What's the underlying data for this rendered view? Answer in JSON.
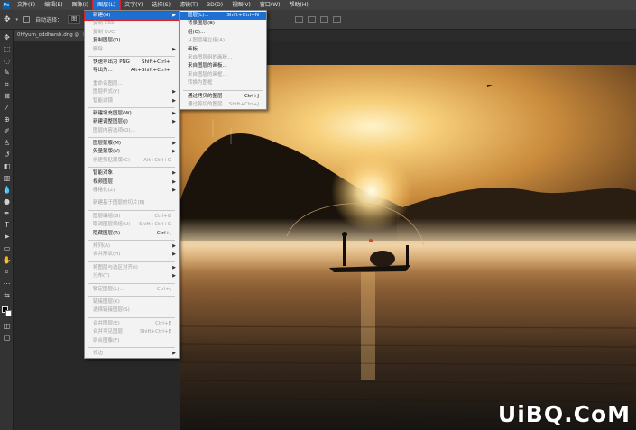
{
  "menubar": {
    "items": [
      {
        "label": "文件(F)"
      },
      {
        "label": "编辑(E)"
      },
      {
        "label": "图像(I)"
      },
      {
        "label": "图层(L)",
        "active": true
      },
      {
        "label": "文字(Y)"
      },
      {
        "label": "选择(S)"
      },
      {
        "label": "滤镜(T)"
      },
      {
        "label": "3D(D)"
      },
      {
        "label": "视图(V)"
      },
      {
        "label": "窗口(W)"
      },
      {
        "label": "帮助(H)"
      }
    ]
  },
  "options_bar": {
    "auto_select_label": "自动选择：",
    "auto_select_value": "图"
  },
  "document_tab": {
    "title": "0hfyum_oddharsh.dng @"
  },
  "layer_menu": {
    "items": [
      {
        "label": "新建(N)",
        "submenu": true,
        "highlighted": true
      },
      {
        "label": "复制 CSS",
        "disabled": true
      },
      {
        "label": "复制 SVG",
        "disabled": true
      },
      {
        "label": "复制图层(D)...",
        "disabled": false
      },
      {
        "label": "删除",
        "submenu": true,
        "disabled": true
      },
      {
        "separator": true
      },
      {
        "label": "快速导出为 PNG",
        "shortcut": "Shift+Ctrl+'"
      },
      {
        "label": "导出为...",
        "shortcut": "Alt+Shift+Ctrl+'"
      },
      {
        "separator": true
      },
      {
        "label": "重命名图层...",
        "disabled": true
      },
      {
        "label": "图层样式(Y)",
        "submenu": true,
        "disabled": true
      },
      {
        "label": "智能滤镜",
        "submenu": true,
        "disabled": true
      },
      {
        "separator": true
      },
      {
        "label": "新建填充图层(W)",
        "submenu": true
      },
      {
        "label": "新建调整图层(J)",
        "submenu": true
      },
      {
        "label": "图层内容选项(O)...",
        "disabled": true
      },
      {
        "separator": true
      },
      {
        "label": "图层蒙版(M)",
        "submenu": true
      },
      {
        "label": "矢量蒙版(V)",
        "submenu": true
      },
      {
        "label": "创建剪贴蒙版(C)",
        "shortcut": "Alt+Ctrl+G",
        "disabled": true
      },
      {
        "separator": true
      },
      {
        "label": "智能对象",
        "submenu": true
      },
      {
        "label": "视频图层",
        "submenu": true
      },
      {
        "label": "栅格化(Z)",
        "submenu": true,
        "disabled": true
      },
      {
        "separator": true
      },
      {
        "label": "新建基于图层的切片(B)",
        "disabled": true
      },
      {
        "separator": true
      },
      {
        "label": "图层编组(G)",
        "shortcut": "Ctrl+G",
        "disabled": true
      },
      {
        "label": "取消图层编组(U)",
        "shortcut": "Shift+Ctrl+G",
        "disabled": true
      },
      {
        "label": "隐藏图层(R)",
        "shortcut": "Ctrl+,"
      },
      {
        "separator": true
      },
      {
        "label": "排列(A)",
        "submenu": true,
        "disabled": true
      },
      {
        "label": "合并形状(H)",
        "submenu": true,
        "disabled": true
      },
      {
        "separator": true
      },
      {
        "label": "将图层与选区对齐(I)",
        "submenu": true,
        "disabled": true
      },
      {
        "label": "分布(T)",
        "submenu": true,
        "disabled": true
      },
      {
        "separator": true
      },
      {
        "label": "锁定图层(L)...",
        "shortcut": "Ctrl+/",
        "disabled": true
      },
      {
        "separator": true
      },
      {
        "label": "链接图层(K)",
        "disabled": true
      },
      {
        "label": "选择链接图层(S)",
        "disabled": true
      },
      {
        "separator": true
      },
      {
        "label": "合并图层(E)",
        "shortcut": "Ctrl+E",
        "disabled": true
      },
      {
        "label": "合并可见图层",
        "shortcut": "Shift+Ctrl+E",
        "disabled": true
      },
      {
        "label": "拼合图像(F)",
        "disabled": true
      },
      {
        "separator": true
      },
      {
        "label": "修边",
        "submenu": true,
        "disabled": true
      }
    ]
  },
  "new_submenu": {
    "items": [
      {
        "label": "图层(L)...",
        "shortcut": "Shift+Ctrl+N",
        "highlighted": true
      },
      {
        "label": "背景图层(B)"
      },
      {
        "label": "组(G)..."
      },
      {
        "label": "从图层建立组(A)...",
        "disabled": true
      },
      {
        "label": "画板..."
      },
      {
        "label": "来自图层组的画板...",
        "disabled": true
      },
      {
        "label": "来自图层的画板..."
      },
      {
        "label": "来自图层的画框...",
        "disabled": true
      },
      {
        "label": "转换为图框",
        "disabled": true
      },
      {
        "separator": true
      },
      {
        "label": "通过拷贝的图层",
        "shortcut": "Ctrl+J"
      },
      {
        "label": "通过剪切的图层",
        "shortcut": "Shift+Ctrl+J",
        "disabled": true
      }
    ]
  },
  "watermark": {
    "text": "UiBQ.CoM"
  },
  "colors": {
    "accent": "#1f6fd1",
    "highlight_border": "#e02020",
    "menu_bg": "#f3f3f3",
    "app_bg": "#262626"
  }
}
